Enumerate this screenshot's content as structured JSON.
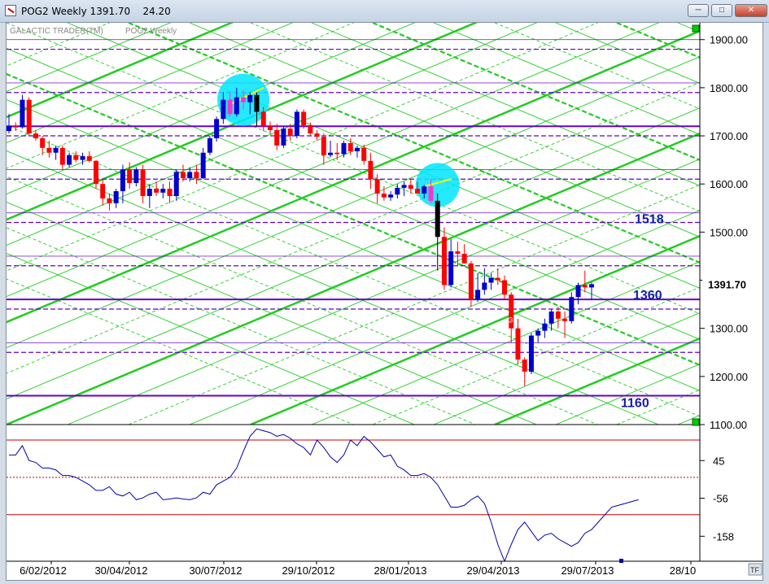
{
  "window": {
    "title": "POG2 Weekly 1391.70    24.20",
    "buttons": [
      "minimize",
      "maximize",
      "close"
    ]
  },
  "chart": {
    "header_left": "GALACTIC TRADER(TM)",
    "header_right": "POG2 Weekly",
    "tf_badge": "TF"
  },
  "colors": {
    "up_candle": "#0000cc",
    "down_candle": "#ff0000",
    "highlight_candle": "#ff33cc",
    "grid_green": "#22cc22",
    "support_purple": "#6600cc",
    "oscillator": "#0000aa",
    "highlight_circle": "#00e5ff"
  },
  "chart_data": [
    {
      "type": "candlestick",
      "y_ticks": [
        "1900.00",
        "1800.00",
        "1700.00",
        "1600.00",
        "1500.00",
        "1400.00",
        "1300.00",
        "1200.00",
        "1100.00"
      ],
      "ylim": [
        1100,
        1935
      ],
      "x_tick_labels": [
        "6/02/2012",
        "30/04/2012",
        "30/07/2012",
        "29/10/2012",
        "28/01/2013",
        "29/04/2013",
        "29/07/2013",
        "28/10"
      ],
      "last_price_label": "1391.70",
      "levels": [
        1160,
        1360,
        1518
      ],
      "level_labels": [
        "1160",
        "1360",
        "1518"
      ],
      "candle_markers": [
        "3",
        "7",
        "4"
      ],
      "series": [
        {
          "name": "POG2 Weekly",
          "ohlc": [
            [
              1710,
              1745,
              1705,
              1720
            ],
            [
              1720,
              1728,
              1710,
              1718
            ],
            [
              1718,
              1785,
              1715,
              1775
            ],
            [
              1775,
              1780,
              1700,
              1705
            ],
            [
              1705,
              1712,
              1690,
              1695
            ],
            [
              1695,
              1700,
              1660,
              1675
            ],
            [
              1675,
              1690,
              1655,
              1665
            ],
            [
              1665,
              1680,
              1650,
              1675
            ],
            [
              1675,
              1680,
              1630,
              1640
            ],
            [
              1640,
              1665,
              1635,
              1660
            ],
            [
              1660,
              1668,
              1645,
              1650
            ],
            [
              1650,
              1665,
              1640,
              1658
            ],
            [
              1658,
              1668,
              1645,
              1648
            ],
            [
              1648,
              1650,
              1590,
              1600
            ],
            [
              1600,
              1610,
              1555,
              1570
            ],
            [
              1570,
              1580,
              1545,
              1560
            ],
            [
              1560,
              1590,
              1550,
              1585
            ],
            [
              1585,
              1640,
              1560,
              1630
            ],
            [
              1630,
              1645,
              1590,
              1602
            ],
            [
              1602,
              1635,
              1595,
              1630
            ],
            [
              1630,
              1640,
              1560,
              1575
            ],
            [
              1575,
              1600,
              1550,
              1590
            ],
            [
              1590,
              1605,
              1575,
              1582
            ],
            [
              1582,
              1600,
              1570,
              1590
            ],
            [
              1590,
              1605,
              1560,
              1575
            ],
            [
              1575,
              1630,
              1565,
              1625
            ],
            [
              1625,
              1640,
              1605,
              1612
            ],
            [
              1612,
              1635,
              1605,
              1625
            ],
            [
              1625,
              1640,
              1600,
              1612
            ],
            [
              1612,
              1675,
              1610,
              1665
            ],
            [
              1665,
              1700,
              1660,
              1695
            ],
            [
              1695,
              1740,
              1688,
              1735
            ],
            [
              1735,
              1790,
              1725,
              1775
            ],
            [
              1775,
              1790,
              1740,
              1745
            ],
            [
              1745,
              1800,
              1740,
              1780
            ],
            [
              1780,
              1795,
              1755,
              1770
            ],
            [
              1770,
              1790,
              1745,
              1785
            ],
            [
              1785,
              1790,
              1720,
              1750
            ],
            [
              1750,
              1760,
              1710,
              1720
            ],
            [
              1720,
              1730,
              1705,
              1712
            ],
            [
              1712,
              1725,
              1670,
              1680
            ],
            [
              1680,
              1720,
              1675,
              1715
            ],
            [
              1715,
              1725,
              1690,
              1700
            ],
            [
              1700,
              1755,
              1695,
              1750
            ],
            [
              1750,
              1755,
              1715,
              1722
            ],
            [
              1722,
              1728,
              1700,
              1705
            ],
            [
              1705,
              1712,
              1690,
              1698
            ],
            [
              1698,
              1705,
              1640,
              1660
            ],
            [
              1660,
              1690,
              1655,
              1665
            ],
            [
              1665,
              1685,
              1650,
              1662
            ],
            [
              1662,
              1690,
              1655,
              1685
            ],
            [
              1685,
              1695,
              1660,
              1668
            ],
            [
              1668,
              1680,
              1655,
              1675
            ],
            [
              1675,
              1682,
              1640,
              1648
            ],
            [
              1648,
              1665,
              1590,
              1610
            ],
            [
              1610,
              1620,
              1560,
              1580
            ],
            [
              1580,
              1595,
              1565,
              1572
            ],
            [
              1572,
              1585,
              1565,
              1578
            ],
            [
              1578,
              1600,
              1570,
              1592
            ],
            [
              1592,
              1605,
              1575,
              1598
            ],
            [
              1598,
              1610,
              1580,
              1590
            ],
            [
              1590,
              1605,
              1580,
              1580
            ],
            [
              1580,
              1598,
              1570,
              1595
            ],
            [
              1595,
              1610,
              1560,
              1565
            ],
            [
              1565,
              1580,
              1420,
              1490
            ],
            [
              1490,
              1510,
              1380,
              1390
            ],
            [
              1390,
              1485,
              1385,
              1460
            ],
            [
              1460,
              1480,
              1430,
              1455
            ],
            [
              1455,
              1475,
              1440,
              1435
            ],
            [
              1435,
              1440,
              1345,
              1360
            ],
            [
              1360,
              1415,
              1355,
              1380
            ],
            [
              1380,
              1425,
              1370,
              1395
            ],
            [
              1395,
              1415,
              1380,
              1405
            ],
            [
              1405,
              1425,
              1390,
              1400
            ],
            [
              1400,
              1410,
              1360,
              1370
            ],
            [
              1370,
              1375,
              1270,
              1300
            ],
            [
              1300,
              1320,
              1225,
              1235
            ],
            [
              1235,
              1240,
              1180,
              1210
            ],
            [
              1210,
              1290,
              1205,
              1285
            ],
            [
              1285,
              1300,
              1270,
              1295
            ],
            [
              1295,
              1320,
              1280,
              1310
            ],
            [
              1310,
              1340,
              1295,
              1335
            ],
            [
              1335,
              1345,
              1300,
              1320
            ],
            [
              1320,
              1335,
              1280,
              1315
            ],
            [
              1315,
              1375,
              1310,
              1365
            ],
            [
              1365,
              1395,
              1350,
              1390
            ],
            [
              1390,
              1420,
              1375,
              1385
            ],
            [
              1385,
              1395,
              1360,
              1391.7
            ]
          ]
        }
      ]
    },
    {
      "type": "line",
      "y_ticks": [
        "45",
        "-56",
        "-158"
      ],
      "ylim": [
        -225,
        135
      ],
      "series": [
        {
          "name": "oscillator",
          "values": [
            60,
            60,
            85,
            45,
            40,
            25,
            25,
            20,
            5,
            5,
            0,
            -10,
            -20,
            -35,
            -35,
            -25,
            -45,
            -50,
            -40,
            -60,
            -55,
            -45,
            -40,
            -60,
            -58,
            -55,
            -58,
            -60,
            -55,
            -40,
            -45,
            -20,
            -10,
            0,
            25,
            70,
            110,
            130,
            125,
            120,
            110,
            115,
            105,
            90,
            80,
            60,
            100,
            80,
            55,
            40,
            60,
            100,
            85,
            110,
            95,
            75,
            55,
            60,
            30,
            20,
            5,
            5,
            10,
            0,
            -20,
            -50,
            -80,
            -80,
            -75,
            -60,
            -50,
            -70,
            -120,
            -180,
            -225,
            -180,
            -140,
            -120,
            -145,
            -170,
            -155,
            -150,
            -165,
            -175,
            -185,
            -175,
            -150,
            -140,
            -120,
            -100,
            -80,
            -75,
            -70,
            -65,
            -60
          ]
        }
      ]
    }
  ]
}
